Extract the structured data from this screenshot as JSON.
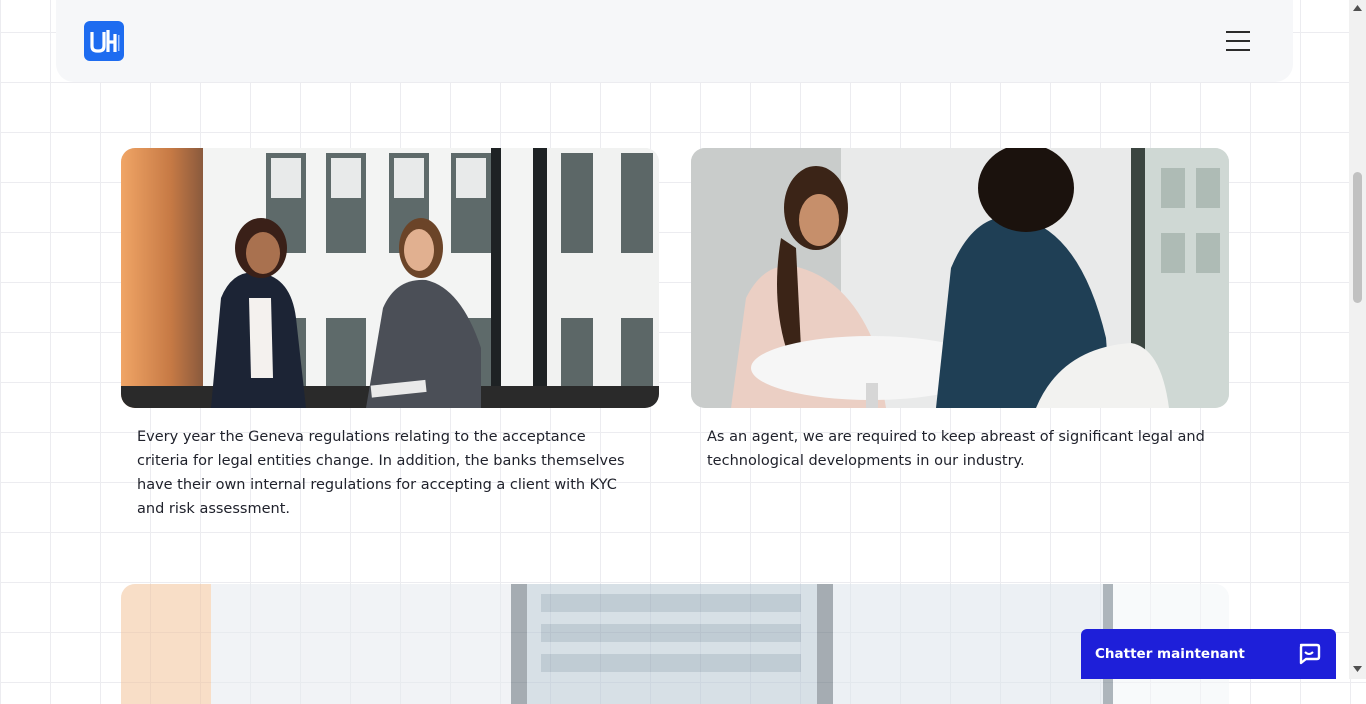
{
  "header": {
    "logo_label": "UH",
    "menu_label": "Menu"
  },
  "cards": [
    {
      "image_alt": "Two women talking by a window",
      "text": "Every year the Geneva regulations relating to the acceptance criteria for legal entities change. In addition, the banks themselves have their own internal regulations for accepting a client with KYC and risk assessment."
    },
    {
      "image_alt": "Woman in a meeting at a round table",
      "text": "As an agent, we are required to keep abreast of significant legal and technological developments in our industry."
    }
  ],
  "chat": {
    "label": "Chatter maintenant",
    "icon": "chat-bubble-icon",
    "color": "#1e1fd9"
  },
  "colors": {
    "accent": "#1e6cf0",
    "header_bg": "#f6f7f9"
  }
}
